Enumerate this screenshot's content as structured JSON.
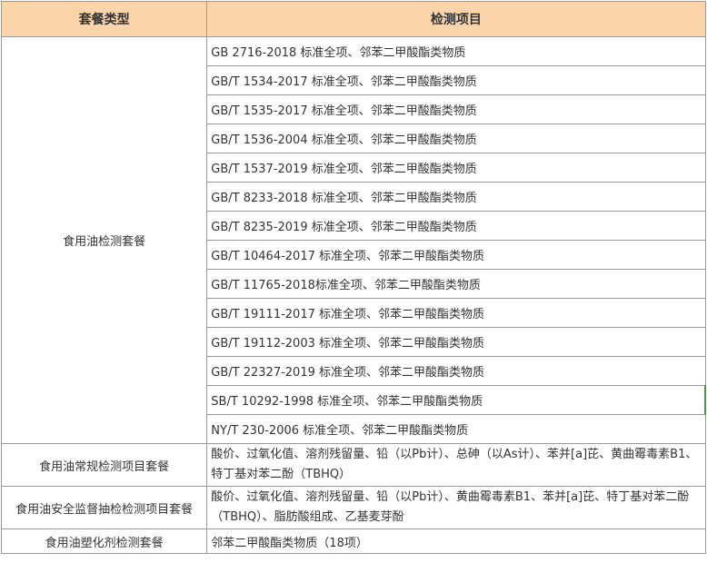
{
  "headers": {
    "type": "套餐类型",
    "items": "检测项目"
  },
  "packages": [
    {
      "type": "食用油检测套餐",
      "items": [
        "GB 2716-2018 标准全项、邻苯二甲酸酯类物质",
        "GB/T 1534-2017 标准全项、邻苯二甲酸酯类物质",
        "GB/T 1535-2017 标准全项、邻苯二甲酸酯类物质",
        "GB/T 1536-2004 标准全项、邻苯二甲酸酯类物质",
        "GB/T 1537-2019 标准全项、邻苯二甲酸酯类物质",
        "GB/T 8233-2018 标准全项、邻苯二甲酸酯类物质",
        "GB/T 8235-2019 标准全项、邻苯二甲酸酯类物质",
        "GB/T 10464-2017 标准全项、邻苯二甲酸酯类物质",
        "GB/T 11765-2018标准全项、邻苯二甲酸酯类物质",
        "GB/T 19111-2017 标准全项、邻苯二甲酸酯类物质",
        "GB/T 19112-2003 标准全项、邻苯二甲酸酯类物质",
        "GB/T 22327-2019 标准全项、邻苯二甲酸酯类物质",
        "SB/T 10292-1998 标准全项、邻苯二甲酸酯类物质",
        "NY/T 230-2006 标准全项、邻苯二甲酸酯类物质"
      ]
    },
    {
      "type": "食用油常规检测项目套餐",
      "items": [
        "酸价、过氧化值、溶剂残留量、铅（以Pb计）、总砷（以As计）、苯并[a]芘、黄曲霉毒素B1、特丁基对苯二酚（TBHQ）"
      ]
    },
    {
      "type": "食用油安全监督抽检检测项目套餐",
      "items": [
        "酸价、过氧化值、溶剂残留量、铅（以Pb计）、黄曲霉毒素B1、苯并[a]芘、特丁基对苯二酚（TBHQ）、脂肪酸组成、乙基麦芽酚"
      ]
    },
    {
      "type": "食用油塑化剂检测套餐",
      "items": [
        "邻苯二甲酸酯类物质（18项）"
      ]
    }
  ]
}
